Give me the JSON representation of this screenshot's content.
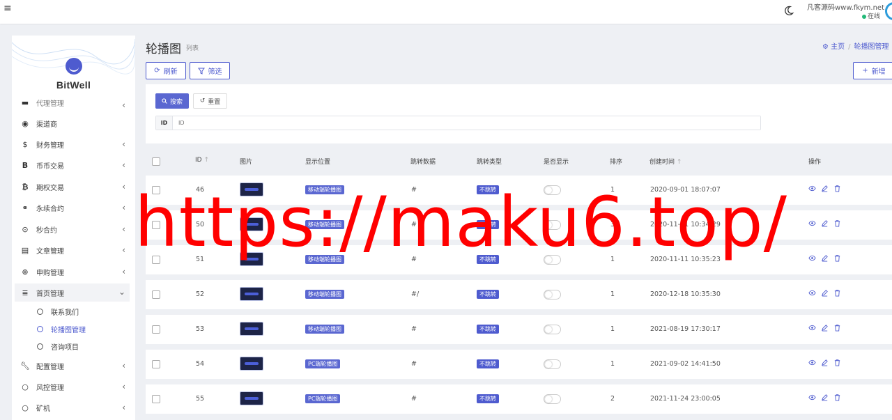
{
  "topbar": {
    "site_name": "凡客源码www.fkym.net",
    "status": "在线"
  },
  "sidebar": {
    "brand": "BitWell",
    "items": [
      {
        "label": "代理管理",
        "icon": "id-card-icon",
        "has_children": true
      },
      {
        "label": "渠道商",
        "icon": "user-circle-icon",
        "has_children": false
      },
      {
        "label": "财务管理",
        "icon": "dollar-icon",
        "has_children": true
      },
      {
        "label": "币币交易",
        "icon": "bitcoin-icon",
        "has_children": true
      },
      {
        "label": "期权交易",
        "icon": "bitcoin-icon",
        "has_children": true
      },
      {
        "label": "永续合约",
        "icon": "link-icon",
        "has_children": true
      },
      {
        "label": "秒合约",
        "icon": "dot-circle-icon",
        "has_children": true
      },
      {
        "label": "文章管理",
        "icon": "newspaper-icon",
        "has_children": true
      },
      {
        "label": "申购管理",
        "icon": "life-ring-icon",
        "has_children": true
      },
      {
        "label": "首页管理",
        "icon": "list-icon",
        "has_children": true,
        "expanded": true
      },
      {
        "label": "配置管理",
        "icon": "wrench-icon",
        "has_children": true
      },
      {
        "label": "风控管理",
        "icon": "circle-icon",
        "has_children": true
      },
      {
        "label": "矿机",
        "icon": "circle-icon",
        "has_children": true
      }
    ],
    "sub_items": [
      {
        "label": "联系我们",
        "active": false
      },
      {
        "label": "轮播图管理",
        "active": true
      },
      {
        "label": "咨询项目",
        "active": false
      }
    ]
  },
  "header": {
    "title": "轮播图",
    "subtitle": "列表",
    "breadcrumb": [
      "主页",
      "轮播图管理"
    ]
  },
  "toolbar": {
    "refresh": "刷新",
    "filter": "筛选",
    "add": "新增"
  },
  "filter": {
    "search": "搜索",
    "reset": "重置",
    "id_label": "ID",
    "id_placeholder": "ID"
  },
  "table": {
    "columns": [
      "ID",
      "图片",
      "显示位置",
      "跳转数据",
      "跳转类型",
      "是否显示",
      "排序",
      "创建时间",
      "操作"
    ],
    "rows": [
      {
        "id": "46",
        "position": "移动端轮播图",
        "jump_data": "#",
        "jump_type": "不跳转",
        "show": false,
        "sort": "1",
        "created": "2020-09-01 18:07:07"
      },
      {
        "id": "50",
        "position": "移动端轮播图",
        "jump_data": "#",
        "jump_type": "不跳转",
        "show": false,
        "sort": "3",
        "created": "2020-11-11 10:34:29"
      },
      {
        "id": "51",
        "position": "移动端轮播图",
        "jump_data": "#",
        "jump_type": "不跳转",
        "show": false,
        "sort": "1",
        "created": "2020-11-11 10:35:23"
      },
      {
        "id": "52",
        "position": "移动端轮播图",
        "jump_data": "#/",
        "jump_type": "不跳转",
        "show": false,
        "sort": "1",
        "created": "2020-12-18 10:35:30"
      },
      {
        "id": "53",
        "position": "移动端轮播图",
        "jump_data": "#",
        "jump_type": "不跳转",
        "show": false,
        "sort": "1",
        "created": "2021-08-19 17:30:17"
      },
      {
        "id": "54",
        "position": "PC端轮播图",
        "jump_data": "#",
        "jump_type": "不跳转",
        "show": false,
        "sort": "1",
        "created": "2021-09-02 14:41:50"
      },
      {
        "id": "55",
        "position": "PC端轮播图",
        "jump_data": "#",
        "jump_type": "不跳转",
        "show": false,
        "sort": "2",
        "created": "2021-11-24 23:00:05"
      }
    ]
  },
  "watermark": "https://maku6.top/",
  "colors": {
    "accent": "#4e5bcf",
    "watermark": "#ff0000"
  }
}
